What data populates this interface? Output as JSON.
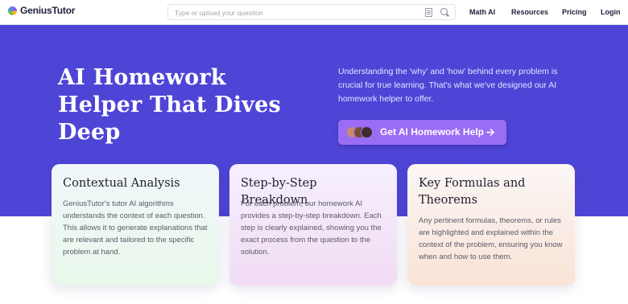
{
  "header": {
    "brand": "GeniusTutor",
    "search_placeholder": "Type or upload your question",
    "nav": [
      "Math AI",
      "Resources",
      "Pricing",
      "Login"
    ]
  },
  "hero": {
    "title": "AI Homework Helper That Dives Deep",
    "description": "Understanding the 'why' and 'how' behind every problem is crucial for true learning. That's what we've designed our AI homework helper to offer.",
    "cta_label": "Get AI Homework Help",
    "cta_icon": "arrow-right-icon"
  },
  "cards": [
    {
      "title": "Contextual Analysis",
      "body": "GeniusTutor's tutor AI algorithms understands the context of each question. This allows it to generate explanations that are relevant and tailored to the specific problem at hand."
    },
    {
      "title": "Step-by-Step Breakdown",
      "body": "For each problem, our homework AI provides a step-by-step breakdown. Each step is clearly explained, showing you the exact process from the question to the solution."
    },
    {
      "title": "Key Formulas and Theorems",
      "body": "Any pertinent formulas, theorems, or rules are highlighted and explained within the context of the problem, ensuring you know when and how to use them."
    }
  ],
  "colors": {
    "hero_bg": "#4e45d6",
    "cta_bg": "#9b6cf4",
    "card1_gradient": "#f1f7fb-#e9f7ea",
    "card2_gradient": "#f6efff-#f1dcf3",
    "card3_gradient": "#fbf6f5-#f9e3d6"
  }
}
